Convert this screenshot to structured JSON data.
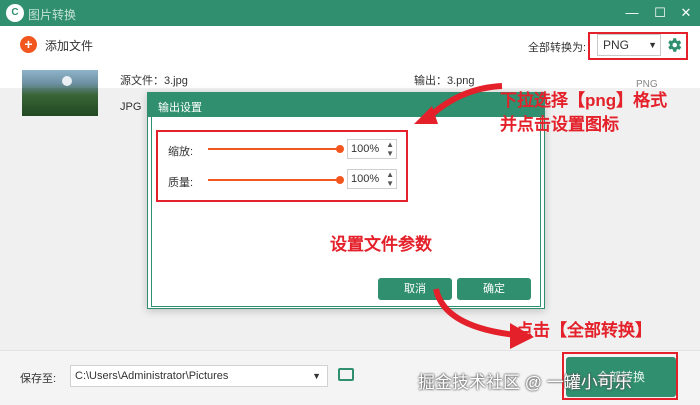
{
  "app": {
    "title": "图片转换"
  },
  "toolbar": {
    "add_file_label": "添加文件",
    "convert_all_label": "全部转换为:",
    "format_value": "PNG"
  },
  "file": {
    "source": "源文件：3.jpg",
    "source_type": "JPG",
    "output": "输出：3.png",
    "output_type": "PNG"
  },
  "dialog": {
    "title": "输出设置",
    "scale_label": "缩放:",
    "scale_value": "100%",
    "quality_label": "质量:",
    "quality_value": "100%",
    "cancel_label": "取消",
    "ok_label": "确定"
  },
  "bottom": {
    "save_label": "保存至:",
    "save_path": "C:\\Users\\Administrator\\Pictures",
    "convert_all_button": "全部转换"
  },
  "annotations": {
    "line1": "下拉选择【png】格式",
    "line2": "并点击设置图标",
    "params": "设置文件参数",
    "convert": "点击【全部转换】",
    "color": "#e4202a"
  },
  "watermark": "掘金技术社区 @ 一罐小可乐",
  "colors": {
    "brand": "#2f8f6e",
    "accent": "#f2571f"
  }
}
